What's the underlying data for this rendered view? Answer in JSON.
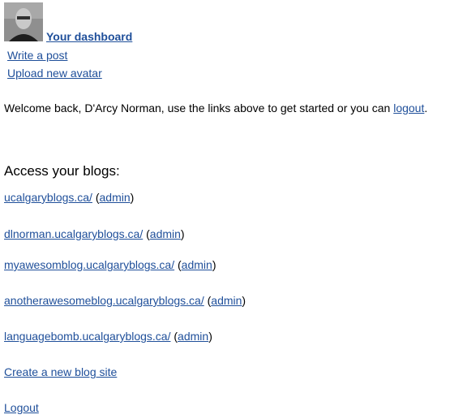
{
  "user": {
    "avatar_icon": "user-avatar-photo",
    "dashboard_label": "Your dashboard",
    "links": [
      "Write a post",
      "Upload new avatar"
    ]
  },
  "welcome": {
    "text_before": "Welcome back, D'Arcy Norman, use the links above to get started or you can ",
    "logout_label": "logout",
    "text_after": "."
  },
  "blogs": {
    "heading": "Access your blogs:",
    "items": [
      {
        "url": "ucalgaryblogs.ca/",
        "admin": "admin"
      },
      {
        "url": "dlnorman.ucalgaryblogs.ca/",
        "admin": "admin"
      },
      {
        "url": "myawesomblog.ucalgaryblogs.ca/",
        "admin": "admin"
      },
      {
        "url": "anotherawesomeblog.ucalgaryblogs.ca/",
        "admin": "admin"
      },
      {
        "url": "languagebomb.ucalgaryblogs.ca/",
        "admin": "admin"
      }
    ],
    "paren_open": "(",
    "paren_close": ")"
  },
  "footer": {
    "create_label": "Create a new blog site",
    "logout_label": "Logout"
  },
  "colors": {
    "link": "#1f4f9a",
    "text": "#000000",
    "background": "#ffffff"
  }
}
